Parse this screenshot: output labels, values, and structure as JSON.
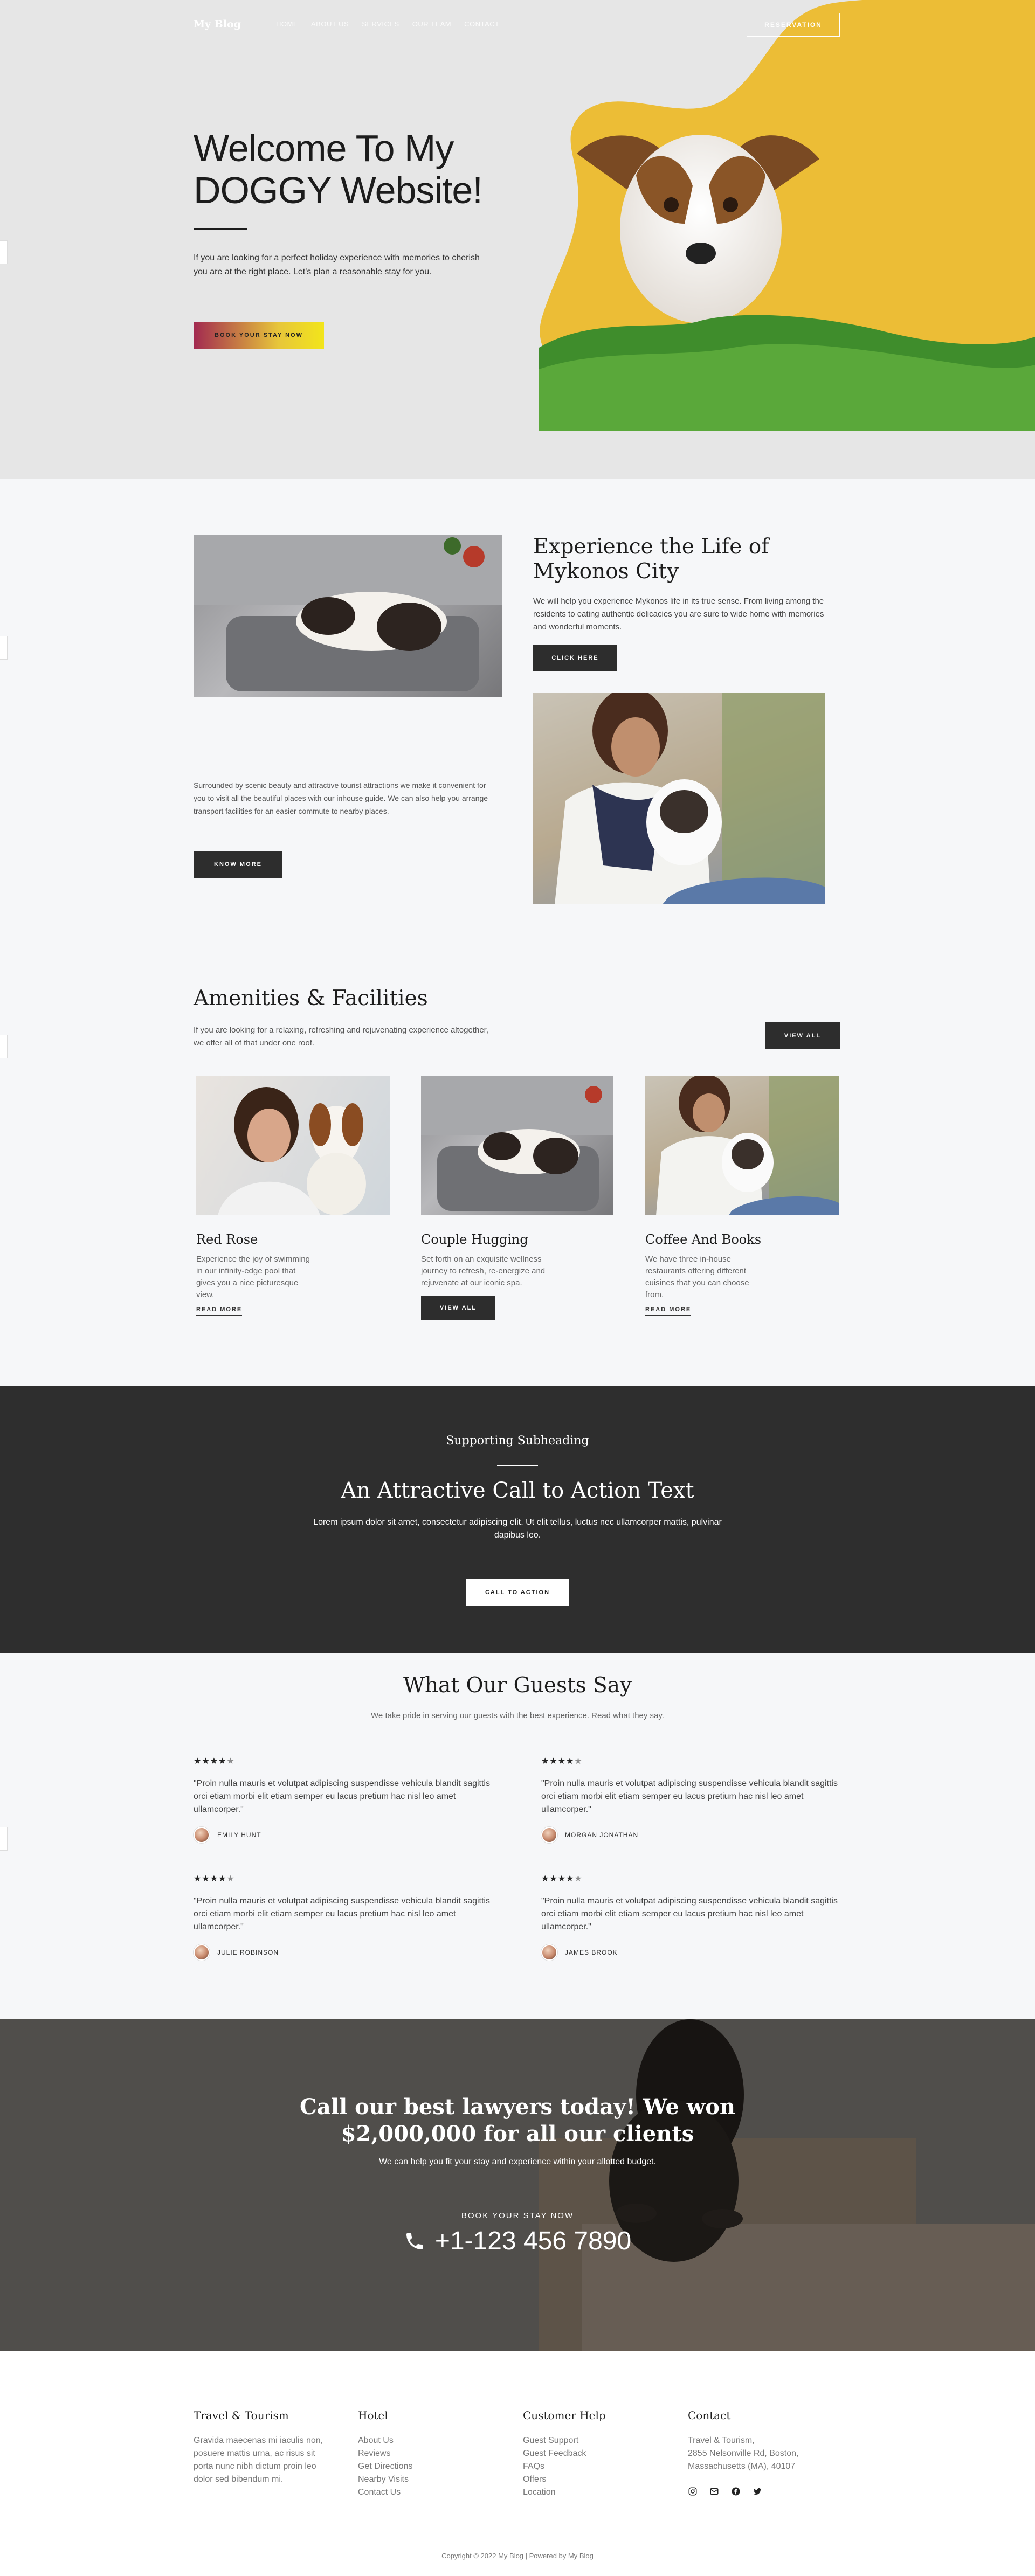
{
  "header": {
    "logo": "My Blog",
    "nav": [
      "HOME",
      "ABOUT US",
      "SERVICES",
      "OUR TEAM",
      "CONTACT"
    ],
    "reservation_label": "RESERVATION"
  },
  "hero": {
    "title_line1": "Welcome To My",
    "title_line2": "DOGGY Website!",
    "text_line1": "If you are looking for a perfect holiday experience with memories to cherish",
    "text_line2": "you are at the right place. Let's plan a reasonable stay for you.",
    "button_label": "BOOK YOUR STAY NOW"
  },
  "experience": {
    "heading": "Experience the Life of Mykonos City",
    "text": "We will help you experience Mykonos life in its true sense. From living among the residents to eating authentic delicacies you are sure to wide home with memories and wonderful moments.",
    "click_label": "CLICK HERE",
    "left_text": "Surrounded by scenic beauty and attractive tourist attractions we make it convenient for you to visit all the beautiful places with our inhouse guide. We can also help you arrange transport facilities for an easier commute to nearby places.",
    "know_label": "KNOW MORE"
  },
  "amenities": {
    "heading": "Amenities & Facilities",
    "text": "If you are looking for a relaxing, refreshing and rejuvenating experience altogether, we offer all of that under one roof.",
    "view_all_label": "VIEW ALL",
    "cards": [
      {
        "title": "Red Rose",
        "text": "Experience the joy of swimming in our infinity-edge pool that gives you a nice picturesque view.",
        "link": "READ MORE"
      },
      {
        "title": "Couple Hugging",
        "text": "Set forth on an exquisite wellness journey to refresh, re-energize and rejuvenate at our iconic spa.",
        "link": "VIEW ALL"
      },
      {
        "title": "Coffee And Books",
        "text": "We have three in-house restaurants offering different cuisines that you can choose from.",
        "link": "READ MORE"
      }
    ]
  },
  "cta": {
    "subheading": "Supporting Subheading",
    "heading": "An Attractive Call to Action Text",
    "text": "Lorem ipsum dolor sit amet, consectetur adipiscing elit. Ut elit tellus, luctus nec ullamcorper mattis, pulvinar dapibus leo.",
    "button_label": "CALL TO ACTION"
  },
  "testimonials": {
    "heading": "What Our Guests Say",
    "subtext": "We take pride in serving our guests with the best experience. Read what they say.",
    "rating": 4.5,
    "quote": "\"Proin nulla mauris et volutpat adipiscing suspendisse vehicula blandit sagittis orci etiam morbi elit etiam semper eu lacus pretium hac nisl leo amet ullamcorper.\"",
    "items": [
      {
        "name": "EMILY HUNT"
      },
      {
        "name": "MORGAN JONATHAN"
      },
      {
        "name": "JULIE ROBINSON"
      },
      {
        "name": "JAMES BROOK"
      }
    ]
  },
  "banner": {
    "heading_line1": "Call our best lawyers today! We won",
    "heading_line2": "$2,000,000 for all our clients",
    "text": "We can help you fit your stay and experience within your allotted budget.",
    "book_label": "BOOK YOUR STAY NOW",
    "phone": "+1-123 456 7890"
  },
  "footer": {
    "col1": {
      "title": "Travel & Tourism",
      "text": "Gravida maecenas mi iaculis non, posuere mattis urna, ac risus sit porta nunc nibh dictum proin leo dolor sed bibendum mi."
    },
    "col2": {
      "title": "Hotel",
      "links": [
        "About Us",
        "Reviews",
        "Get Directions",
        "Nearby Visits",
        "Contact Us"
      ]
    },
    "col3": {
      "title": "Customer Help",
      "links": [
        "Guest Support",
        "Guest Feedback",
        "FAQs",
        "Offers",
        "Location"
      ]
    },
    "col4": {
      "title": "Contact",
      "address_line1": "Travel & Tourism,",
      "address_line2": "2855 Nelsonville Rd, Boston,",
      "address_line3": "Massachusetts (MA), 40107"
    },
    "social_icons": [
      "instagram-icon",
      "mail-icon",
      "facebook-icon",
      "twitter-icon"
    ],
    "copyright": "Copyright © 2022 My Blog | Powered by My Blog"
  }
}
